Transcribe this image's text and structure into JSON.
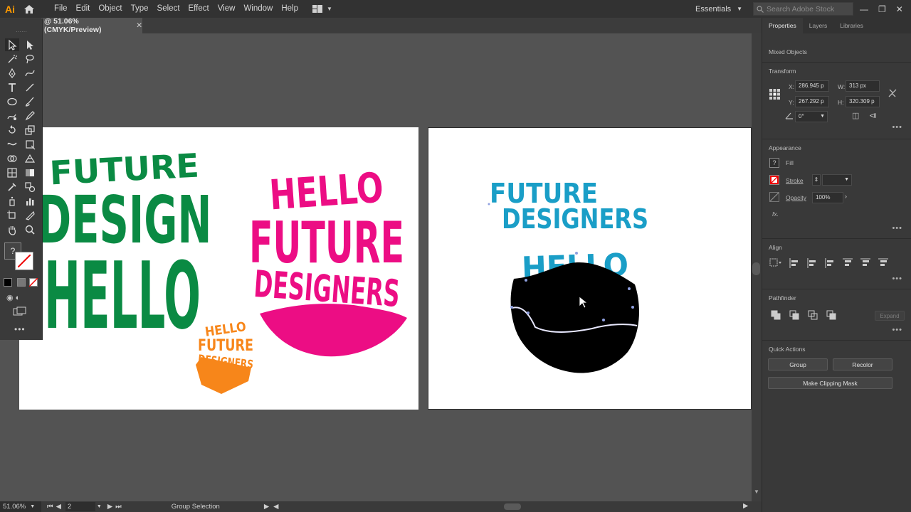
{
  "app": {
    "logo": "Ai",
    "menus": [
      "File",
      "Edit",
      "Object",
      "Type",
      "Select",
      "Effect",
      "View",
      "Window",
      "Help"
    ],
    "workspace": "Essentials",
    "search_placeholder": "Search Adobe Stock"
  },
  "document": {
    "tab_label": "@ 51.06% (CMYK/Preview)",
    "zoom": "51.06%",
    "artboard_number": "2",
    "status": "Group Selection"
  },
  "artwork": {
    "left": {
      "green_lines": [
        "FUTURE",
        "DESIGN",
        "HELLO"
      ],
      "pink_lines": [
        "HELLO",
        "FUTURE",
        "DESIGNERS"
      ],
      "orange_lines": [
        "HELLO",
        "FUTURE",
        "DESIGNERS"
      ]
    },
    "right": {
      "blue_lines": [
        "FUTURE",
        "DESIGNERS"
      ],
      "hello": "HELLO"
    }
  },
  "panel": {
    "tabs": [
      "Properties",
      "Layers",
      "Libraries"
    ],
    "selection_type": "Mixed Objects",
    "transform": {
      "title": "Transform",
      "x_label": "X:",
      "x_value": "286.945 p",
      "y_label": "Y:",
      "y_value": "267.292 p",
      "w_label": "W:",
      "w_value": "313 px",
      "h_label": "H:",
      "h_value": "320.309 p",
      "rotate_value": "0°"
    },
    "appearance": {
      "title": "Appearance",
      "fill": "Fill",
      "stroke": "Stroke",
      "opacity_label": "Opacity",
      "opacity_value": "100%",
      "fx": "fx."
    },
    "align_title": "Align",
    "pathfinder": {
      "title": "Pathfinder",
      "expand": "Expand"
    },
    "quick_actions": {
      "title": "Quick Actions",
      "group": "Group",
      "recolor": "Recolor",
      "clipping": "Make Clipping Mask"
    }
  },
  "colors": {
    "green": "#0a8a43",
    "pink": "#ec0d84",
    "orange": "#f7861a",
    "blue": "#1a9ec7"
  }
}
